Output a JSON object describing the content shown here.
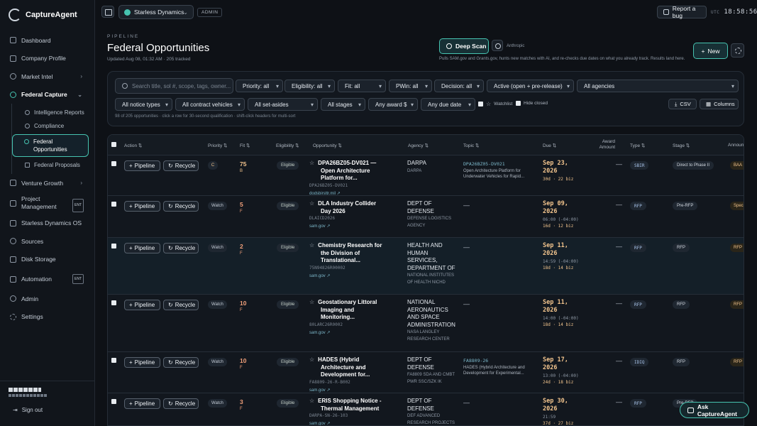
{
  "app": {
    "name": "CaptureAgent"
  },
  "sidebar": {
    "items": [
      {
        "label": "Dashboard",
        "icon": "grid-icon"
      },
      {
        "label": "Company Profile",
        "icon": "building-icon"
      },
      {
        "label": "Market Intel",
        "icon": "globe-icon",
        "chevron": "›"
      },
      {
        "label": "Federal Capture",
        "icon": "target-icon",
        "chevron": "⌄"
      }
    ],
    "sub": [
      {
        "label": "Intelligence Reports"
      },
      {
        "label": "Compliance"
      },
      {
        "label": "Federal Opportunities"
      },
      {
        "label": "Federal Proposals"
      }
    ],
    "items2": [
      {
        "label": "Venture Growth",
        "chevron": "›"
      },
      {
        "label": "Project Management",
        "badge": "ENT"
      },
      {
        "label": "Starless Dynamics OS"
      },
      {
        "label": "Sources"
      },
      {
        "label": "Disk Storage"
      },
      {
        "label": "Automation",
        "badge": "ENT"
      },
      {
        "label": "Admin"
      },
      {
        "label": "Settings"
      }
    ],
    "signout": "Sign out"
  },
  "topbar": {
    "org": "Starless Dynamics",
    "role": "ADMIN",
    "bug": "Report a bug",
    "tz": "UTC",
    "time": "18:58:56"
  },
  "page": {
    "crumb": "PIPELINE",
    "title": "Federal Opportunities",
    "meta": "Updated Aug 08, 01:32 AM · 205 tracked",
    "deep_scan": "Deep Scan",
    "anthropic": "Anthropic",
    "scan_meta": "Pulls SAM.gov and Grants.gov, hunts new matches with AI, and re-checks due dates on what you already track. Results land here.",
    "new": "New"
  },
  "filters": {
    "search_placeholder": "Search title, sol #, scope, tags, owner...",
    "priority": "Priority: all",
    "eligibility": "Eligibility: all",
    "fit": "Fit: all",
    "pwin": "PWin: all",
    "decision": "Decision: all",
    "active": "Active (open + pre-release)",
    "agencies": "All agencies",
    "notice": "All notice types",
    "vehicles": "All contract vehicles",
    "setasides": "All set-asides",
    "stages": "All stages",
    "award": "Any award $",
    "due": "Any due date",
    "watchlist": "Watchlist",
    "hide_closed": "Hide closed",
    "csv": "CSV",
    "columns": "Columns",
    "hint": "98 of 205 opportunities · click a row for 30-second qualification · shift-click headers for multi-sort"
  },
  "table": {
    "headers": {
      "action": "Action ⇅",
      "priority": "Priority ⇅",
      "fit": "Fit ⇅",
      "eligibility": "Eligibility ⇅",
      "opportunity": "Opportunity ⇅",
      "agency": "Agency ⇅",
      "topic": "Topic ⇅",
      "due": "Due ⇅",
      "award": "Award Amount",
      "type": "Type ⇅",
      "stage": "Stage ⇅",
      "announce": "Announ"
    },
    "pipeline": "Pipeline",
    "recycle": "Recycle",
    "watch": "Watch",
    "eligible": "Eligible",
    "rows": [
      {
        "priority": "C",
        "fit": "75",
        "fit_grade": "B",
        "fit_color": "#f2c48d",
        "title": "DPA26BZ05-DV021 — Open Architecture Platform for...",
        "sol": "DPA26BZ05-DV021",
        "link": "dodsbirsttr.mil ↗",
        "agency": "DARPA",
        "agency_sub": "DARPA",
        "topic_code": "DPA26BZ05-DV021",
        "topic_desc": "Open Architecture Platform for Underwater Vehicles for Rapid...",
        "due_date": "Sep 23, 2026",
        "due_time": "",
        "due_biz": "30d · 22 biz",
        "award": "—",
        "type": "SBIR",
        "stage": "Direct to Phase II",
        "announce": "BAA"
      },
      {
        "priority": "Watch",
        "fit": "5",
        "fit_grade": "F",
        "fit_color": "#f2a07a",
        "title": "DLA Industry Collider Day 2026",
        "sol": "DLAICD2026",
        "link": "sam.gov ↗",
        "agency": "DEPT OF DEFENSE",
        "agency_sub": "DEFENSE LOGISTICS AGENCY",
        "topic_code": "",
        "topic_desc": "",
        "topic_dash": "—",
        "due_date": "Sep 09, 2026",
        "due_time": "06:00 (-04:00)",
        "due_biz": "16d · 12 biz",
        "award": "—",
        "type": "RFP",
        "stage": "Pre-RFP",
        "announce": "Speci"
      },
      {
        "priority": "Watch",
        "fit": "2",
        "fit_grade": "F",
        "fit_color": "#f2a07a",
        "title": "Chemistry Research for the Division of Translational...",
        "sol": "75N94826R00002",
        "link": "sam.gov ↗",
        "agency": "HEALTH AND HUMAN SERVICES, DEPARTMENT OF",
        "agency_sub": "NATIONAL INSTITUTES OF HEALTH NICHD",
        "topic_code": "",
        "topic_desc": "",
        "topic_dash": "—",
        "due_date": "Sep 11, 2026",
        "due_time": "14:59 (-04:00)",
        "due_biz": "18d · 14 biz",
        "award": "—",
        "type": "RFP",
        "stage": "RFP",
        "announce": "RFP"
      },
      {
        "priority": "Watch",
        "fit": "10",
        "fit_grade": "F",
        "fit_color": "#f2a07a",
        "title": "Geostationary Littoral Imaging and Monitoring...",
        "sol": "80LARC26R0002",
        "link": "sam.gov ↗",
        "agency": "NATIONAL AERONAUTICS AND SPACE ADMINISTRATION",
        "agency_sub": "NASA LANGLEY RESEARCH CENTER",
        "topic_code": "",
        "topic_desc": "",
        "topic_dash": "—",
        "due_date": "Sep 11, 2026",
        "due_time": "14:00 (-04:00)",
        "due_biz": "18d · 14 biz",
        "award": "—",
        "type": "RFP",
        "stage": "RFP",
        "announce": "RFP"
      },
      {
        "priority": "Watch",
        "fit": "10",
        "fit_grade": "F",
        "fit_color": "#f2a07a",
        "title": "HADES (Hybrid Architecture and Development for...",
        "sol": "FA8809-26-R-B002",
        "link": "sam.gov ↗",
        "agency": "DEPT OF DEFENSE",
        "agency_sub": "FA8809 SDA AND CMBT PWR SSC/SZK IK",
        "topic_code": "FA8809-26",
        "topic_desc": "HADES (Hybrid Architecture and Development for Experimental...",
        "due_date": "Sep 17, 2026",
        "due_time": "13:00 (-04:00)",
        "due_biz": "24d · 18 biz",
        "award": "—",
        "type": "IDIQ",
        "stage": "RFP",
        "announce": "RFP"
      },
      {
        "priority": "Watch",
        "fit": "3",
        "fit_grade": "F",
        "fit_color": "#f2a07a",
        "title": "ERIS Shopping Notice - Thermal Management",
        "sol": "DARPA-SN-26-103",
        "link": "sam.gov ↗",
        "agency": "DEPT OF DEFENSE",
        "agency_sub": "DEF ADVANCED RESEARCH PROJECTS AGCY",
        "topic_code": "",
        "topic_desc": "",
        "topic_dash": "—",
        "due_date": "Sep 30, 2026",
        "due_time": "21:59",
        "due_biz": "37d · 27 biz",
        "award": "—",
        "type": "RFP",
        "stage": "Pre-RFP",
        "announce": ""
      }
    ]
  },
  "ask": "Ask CaptureAgent"
}
